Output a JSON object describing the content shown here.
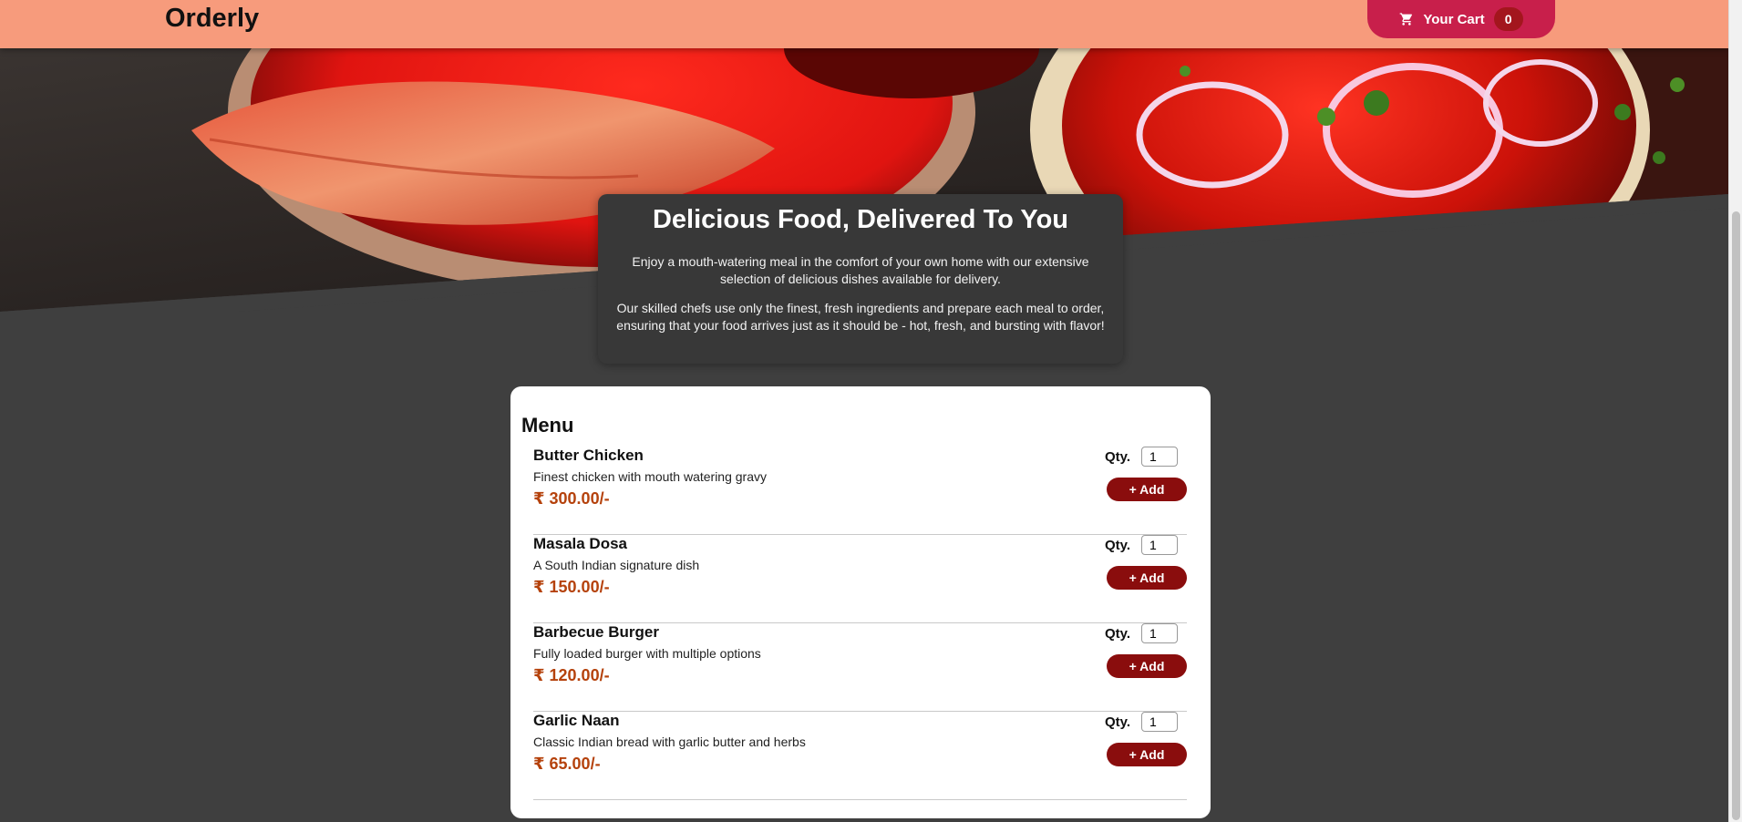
{
  "header": {
    "logo": "Orderly",
    "cart_label": "Your Cart",
    "cart_count": "0",
    "cart_icon": "shopping-cart-icon"
  },
  "summary": {
    "title": "Delicious Food, Delivered To You",
    "paragraph_1": "Enjoy a mouth-watering meal in the comfort of your own home with our extensive selection of delicious dishes available for delivery.",
    "paragraph_2": "Our skilled chefs use only the finest, fresh ingredients and prepare each meal to order, ensuring that your food arrives just as it should be - hot, fresh, and bursting with flavor!"
  },
  "menu": {
    "title": "Menu",
    "qty_label": "Qty.",
    "add_label": "+ Add",
    "items": [
      {
        "name": "Butter Chicken",
        "description": "Finest chicken with mouth watering gravy",
        "price": "₹ 300.00/-",
        "qty": "1"
      },
      {
        "name": "Masala Dosa",
        "description": "A South Indian signature dish",
        "price": "₹ 150.00/-",
        "qty": "1"
      },
      {
        "name": "Barbecue Burger",
        "description": "Fully loaded burger with multiple options",
        "price": "₹ 120.00/-",
        "qty": "1"
      },
      {
        "name": "Garlic Naan",
        "description": "Classic Indian bread with garlic butter and herbs",
        "price": "₹ 65.00/-",
        "qty": "1"
      }
    ]
  },
  "colors": {
    "header_bg": "#f79b7c",
    "cart_button": "#c81f4b",
    "cart_badge": "#a3161d",
    "page_bg": "#3f3f3f",
    "summary_bg": "#383838",
    "add_button": "#8a0d0d",
    "price_text": "#b5420c"
  }
}
